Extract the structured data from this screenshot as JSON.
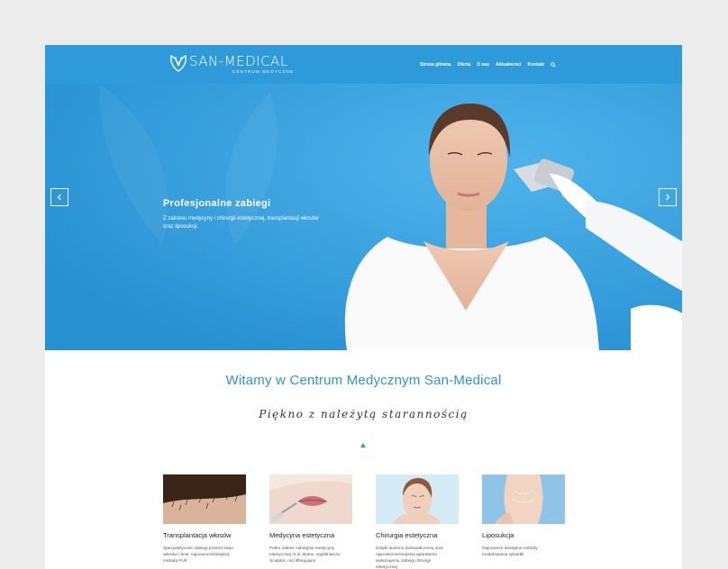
{
  "header": {
    "logo_text": "SAN-MEDICAL",
    "logo_subtitle": "CENTRUM MEDYCZNE",
    "nav_items": [
      "Strona główna",
      "Oferta",
      "O nas",
      "Aktualności",
      "Kontakt"
    ],
    "search_icon": "search-icon"
  },
  "hero": {
    "title": "Profesjonalne zabiegi",
    "description": "Z zakresu medycyny i chirurgii estetycznej, transplantacji włosów oraz liposukcji.",
    "prev_icon": "chevron-left-icon",
    "next_icon": "chevron-right-icon"
  },
  "intro": {
    "heading": "Witamy w Centrum Medycznym San-Medical",
    "tagline": "Piękno z należytą starannością"
  },
  "services": [
    {
      "title": "Transplantacja włosów",
      "text": "Specjalistyczne zabiegi przeszczepu włosów i brwi, najnowocześniejszą metodą FUE"
    },
    {
      "title": "Medycyna estetyczna",
      "text": "Pełen zakres zabiegów medycyny estetycznej m.in. Botox, wypełniacze, Sculptra, nici liftingujące"
    },
    {
      "title": "Chirurgia estetyczna",
      "text": "Dzięki dużemu doświadczeniu oraz najnowocześniejszej aparaturze wykonujemy zabiegi chirurgii estetycznej"
    },
    {
      "title": "Liposukcja",
      "text": "Najnowsze dostępne metody modelowania sylwetki"
    }
  ],
  "colors": {
    "brand_blue": "#2f9ad9",
    "heading_blue": "#2d94d1",
    "page_bg": "#ececec"
  }
}
